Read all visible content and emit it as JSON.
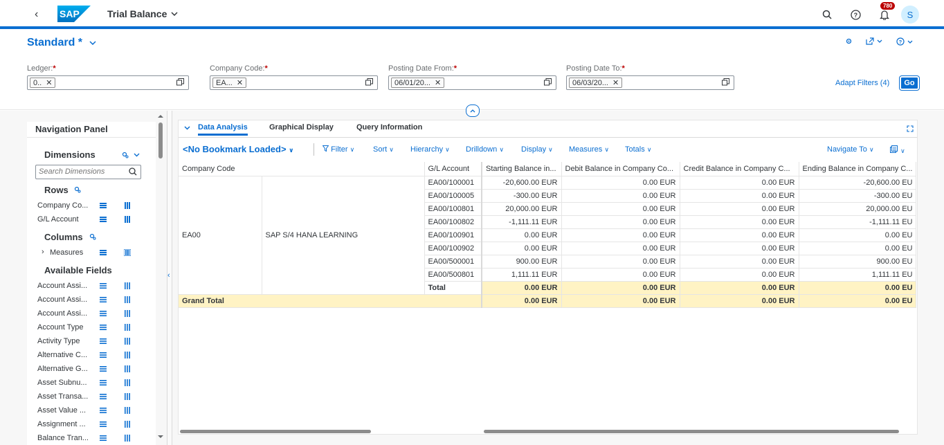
{
  "shell": {
    "title": "Trial Balance",
    "notification_count": "780",
    "avatar_initial": "S"
  },
  "header": {
    "variant": "Standard *",
    "filters": [
      {
        "label": "Ledger:",
        "token": "0.."
      },
      {
        "label": "Company Code:",
        "token": "EA..."
      },
      {
        "label": "Posting Date From:",
        "token": "06/01/20..."
      },
      {
        "label": "Posting Date To:",
        "token": "06/03/20..."
      }
    ],
    "adapt_filters": "Adapt Filters (4)",
    "go": "Go"
  },
  "nav": {
    "title": "Navigation Panel",
    "dimensions": "Dimensions",
    "search_placeholder": "Search Dimensions",
    "rows_heading": "Rows",
    "rows": [
      "Company Co...",
      "G/L Account"
    ],
    "columns_heading": "Columns",
    "measures": "Measures",
    "available_heading": "Available Fields",
    "available": [
      "Account Assi...",
      "Account Assi...",
      "Account Assi...",
      "Account Type",
      "Activity Type",
      "Alternative C...",
      "Alternative G...",
      "Asset Subnu...",
      "Asset Transa...",
      "Asset Value ...",
      "Assignment ...",
      "Balance Tran..."
    ]
  },
  "tabs": [
    "Data Analysis",
    "Graphical Display",
    "Query Information"
  ],
  "toolbar": {
    "bookmark": "<No Bookmark Loaded>",
    "buttons": [
      "Filter",
      "Sort",
      "Hierarchy",
      "Drilldown",
      "Display",
      "Measures",
      "Totals"
    ],
    "navigate": "Navigate To"
  },
  "table": {
    "headers": [
      "Company Code",
      "G/L Account",
      "Starting Balance in...",
      "Debit Balance in Company Co...",
      "Credit Balance in Company C...",
      "Ending Balance in Company C..."
    ],
    "company_code": "EA00",
    "company_name": "SAP S/4 HANA LEARNING",
    "rows": [
      [
        "EA00/100001",
        "-20,600.00 EUR",
        "0.00 EUR",
        "0.00 EUR",
        "-20,600.00 EU"
      ],
      [
        "EA00/100005",
        "-300.00 EUR",
        "0.00 EUR",
        "0.00 EUR",
        "-300.00 EU"
      ],
      [
        "EA00/100801",
        "20,000.00 EUR",
        "0.00 EUR",
        "0.00 EUR",
        "20,000.00 EU"
      ],
      [
        "EA00/100802",
        "-1,111.11 EUR",
        "0.00 EUR",
        "0.00 EUR",
        "-1,111.11 EU"
      ],
      [
        "EA00/100901",
        "0.00 EUR",
        "0.00 EUR",
        "0.00 EUR",
        "0.00 EU"
      ],
      [
        "EA00/100902",
        "0.00 EUR",
        "0.00 EUR",
        "0.00 EUR",
        "0.00 EU"
      ],
      [
        "EA00/500001",
        "900.00 EUR",
        "0.00 EUR",
        "0.00 EUR",
        "900.00 EU"
      ],
      [
        "EA00/500801",
        "1,111.11 EUR",
        "0.00 EUR",
        "0.00 EUR",
        "1,111.11 EU"
      ]
    ],
    "total": [
      "Total",
      "0.00 EUR",
      "0.00 EUR",
      "0.00 EUR",
      "0.00 EU"
    ],
    "grand_total": [
      "Grand Total",
      "0.00 EUR",
      "0.00 EUR",
      "0.00 EUR",
      "0.00 EU"
    ]
  }
}
